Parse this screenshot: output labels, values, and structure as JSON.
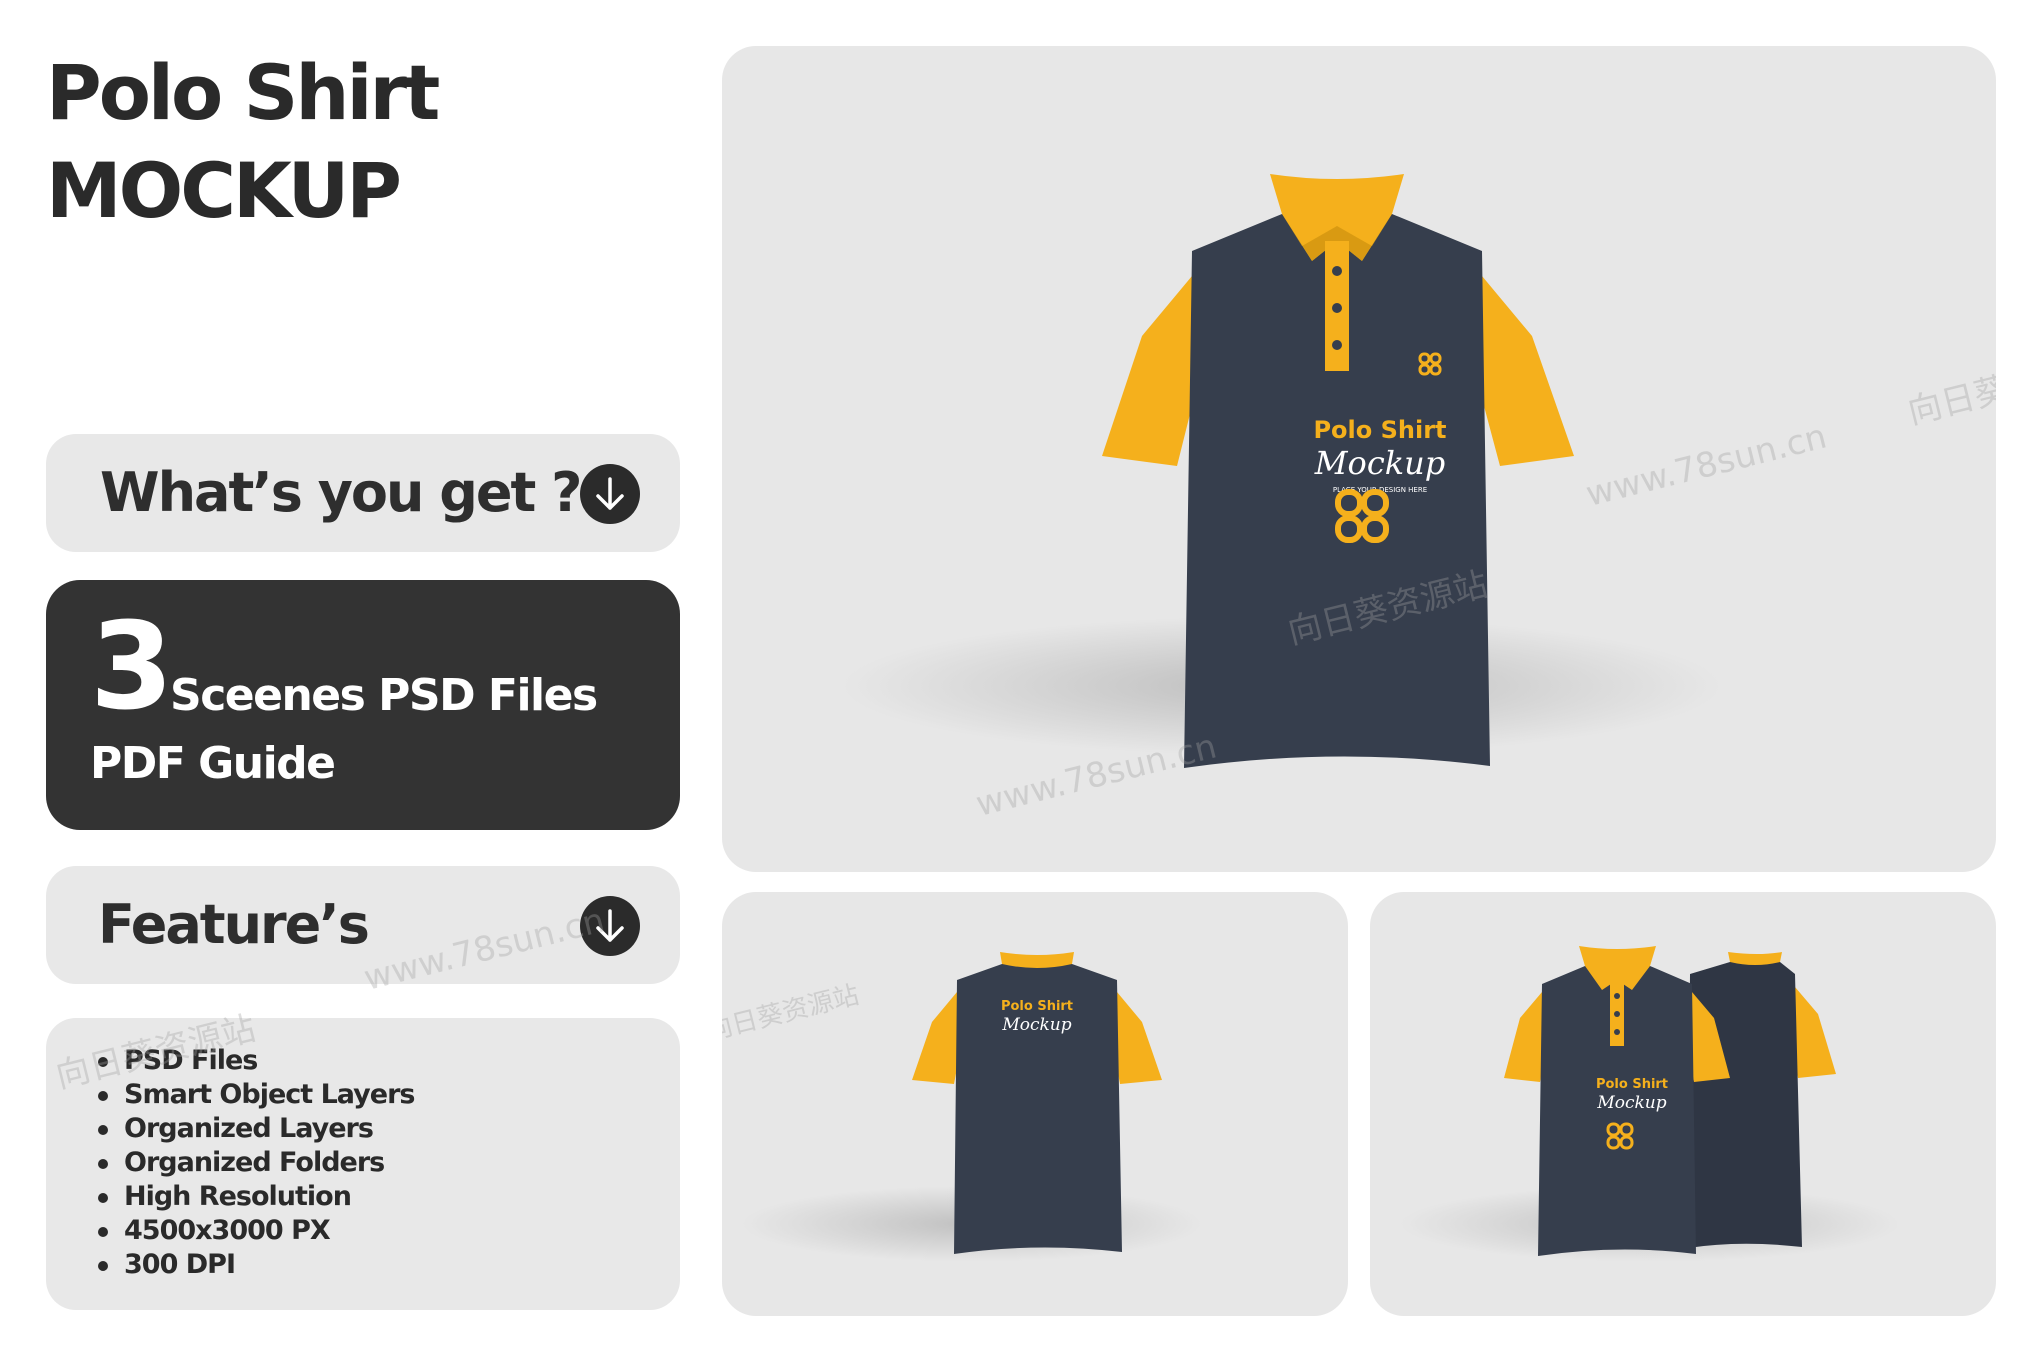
{
  "header": {
    "title_line1": "Polo Shirt",
    "title_line2": "MOCKUP"
  },
  "whats_you_get": {
    "label": "What’s you get ?",
    "icon": "arrow-down-icon"
  },
  "scenes_card": {
    "count": "3",
    "scenes_label": "Sceenes PSD Files",
    "guide_label": "PDF Guide"
  },
  "features": {
    "label": "Feature’s",
    "icon": "arrow-down-icon",
    "items": [
      "PSD Files",
      "Smart Object Layers",
      "Organized Layers",
      "Organized Folders",
      "High Resolution",
      "4500x3000 PX",
      "300 DPI"
    ]
  },
  "shirt_print": {
    "brand_line": "Polo Shirt",
    "script_line": "Mockup",
    "small_line": "PLACE YOUR DESIGN HERE"
  },
  "watermarks": [
    "www.78sun.cn",
    "向日葵资源站"
  ],
  "colors": {
    "shirt_body": "#363e4d",
    "shirt_accent": "#f5b01c",
    "dark_card": "#333333",
    "pill_bg": "#e8e8e8",
    "scene_bg": "#e7e7e7"
  }
}
